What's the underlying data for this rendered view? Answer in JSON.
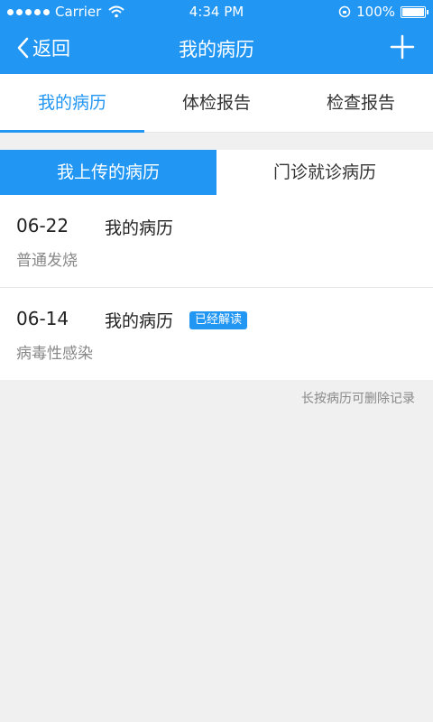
{
  "status_bar": {
    "carrier": "Carrier",
    "time": "4:34 PM",
    "battery": "100%"
  },
  "nav": {
    "back_label": "返回",
    "title": "我的病历"
  },
  "tabs": [
    {
      "label": "我的病历"
    },
    {
      "label": "体检报告"
    },
    {
      "label": "检查报告"
    }
  ],
  "segments": [
    {
      "label": "我上传的病历"
    },
    {
      "label": "门诊就诊病历"
    }
  ],
  "records": [
    {
      "date": "06-22",
      "name": "我的病历",
      "badge": "",
      "diagnosis": "普通发烧"
    },
    {
      "date": "06-14",
      "name": "我的病历",
      "badge": "已经解读",
      "diagnosis": "病毒性感染"
    }
  ],
  "hint": "长按病历可删除记录",
  "colors": {
    "accent": "#2196f3",
    "background": "#f0f0f0"
  }
}
